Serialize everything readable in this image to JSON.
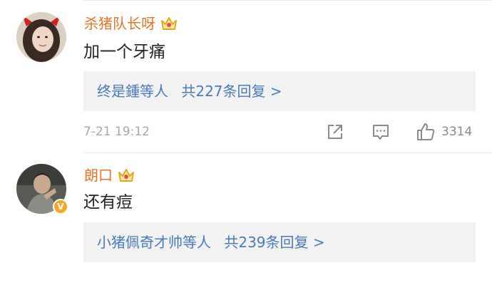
{
  "comments": [
    {
      "username": "杀猪队长呀",
      "text": "加一个牙痛",
      "reply_names": "终是鍾等人",
      "reply_count": "共227条回复 >",
      "time": "7-21 19:12",
      "like_count": "3314"
    },
    {
      "username": "朗口",
      "text": "还有痘",
      "reply_names": "小猪佩奇才帅等人",
      "reply_count": "共239条回复 >",
      "verified_badge": "V"
    }
  ],
  "icons": {
    "crown": "crown-icon",
    "share": "share-icon",
    "comment": "comment-icon",
    "like": "thumbs-up-icon"
  },
  "colors": {
    "username": "#e8742c",
    "link": "#4a7ab8",
    "reply_bg": "#f2f2f2",
    "meta": "#a8a8a8"
  }
}
